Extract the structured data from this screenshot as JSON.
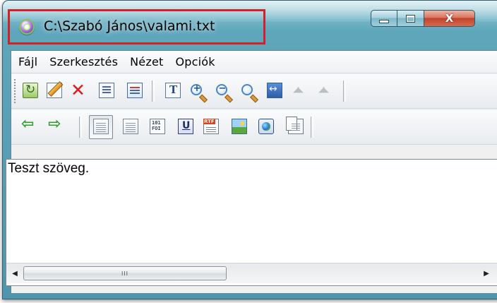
{
  "window": {
    "title": "C:\\Szabó János\\valami.txt",
    "close_glyph": "X",
    "highlight_color": "#d81f26"
  },
  "menu": [
    "Fájl",
    "Szerkesztés",
    "Nézet",
    "Opciók"
  ],
  "toolbar1_icons": [
    "refresh-icon",
    "edit-icon",
    "delete-icon",
    "properties-icon",
    "list-icon",
    "font-icon",
    "zoom-in-icon",
    "zoom-out-icon",
    "zoom-icon",
    "fit-width-icon",
    "mirror-left-icon",
    "mirror-right-icon"
  ],
  "toolbar2_icons": [
    "back-arrow-icon",
    "forward-arrow-icon",
    "text-view-icon",
    "document-view-icon",
    "binary-view-icon",
    "unicode-view-icon",
    "rtf-view-icon",
    "image-view-icon",
    "web-view-icon",
    "multipage-icon"
  ],
  "editor": {
    "content": "Teszt szöveg."
  },
  "scrollbar": {
    "thumb_grip": "III",
    "left_arrow": "◀",
    "right_arrow": "▶"
  }
}
